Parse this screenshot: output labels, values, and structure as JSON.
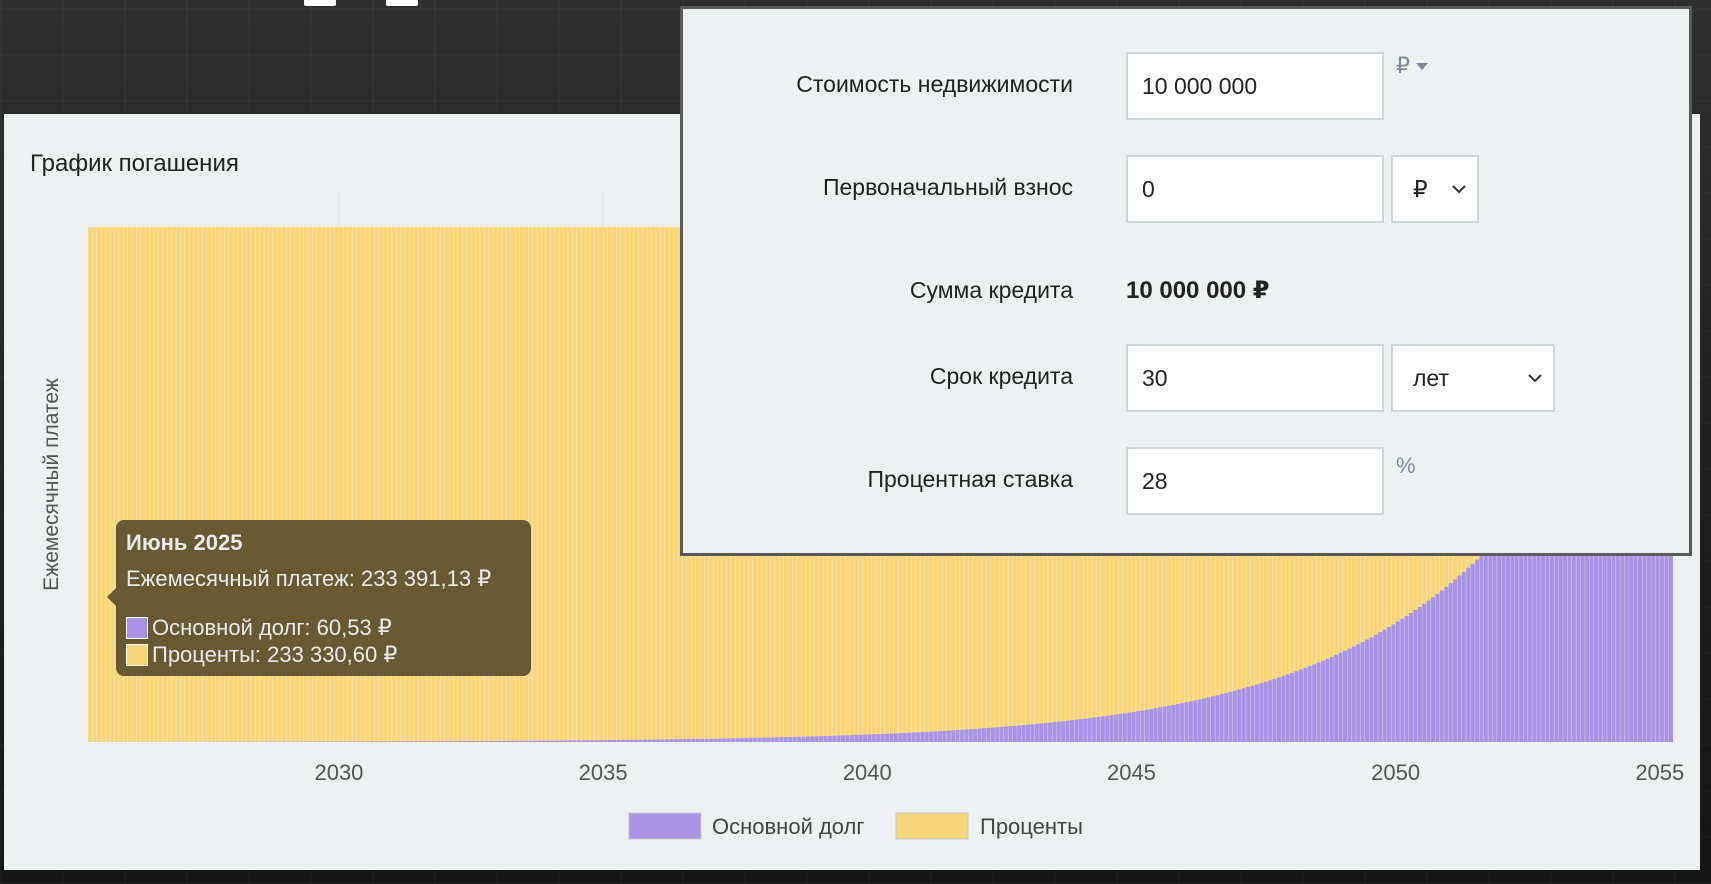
{
  "chart": {
    "title": "График погашения",
    "tooltip": {
      "title": "Июнь 2025",
      "monthly_payment": "Ежемесячный платеж: 233 391,13 ₽",
      "principal": "Основной долг: 60,53 ₽",
      "interest": "Проценты: 233 330,60 ₽"
    }
  },
  "form": {
    "property_cost": {
      "label": "Стоимость недвижимости",
      "value": "10 000 000",
      "unit": "₽"
    },
    "down_payment": {
      "label": "Первоначальный взнос",
      "value": "0",
      "unit_select": "₽"
    },
    "loan_amount": {
      "label": "Сумма кредита",
      "value": "10 000 000 ₽"
    },
    "loan_term": {
      "label": "Срок кредита",
      "value": "30",
      "unit_select": "лет"
    },
    "interest_rate": {
      "label": "Процентная ставка",
      "value": "28",
      "unit": "%"
    }
  },
  "colors": {
    "principal": "#a993e4",
    "interest": "#f8d77a",
    "card_bg": "#ecf0f1",
    "tooltip_bg": "#5c502d"
  },
  "chart_data": {
    "type": "bar",
    "stacked": true,
    "ylabel": "Ежемесячный платеж",
    "x_ticks": [
      "2030",
      "2035",
      "2040",
      "2045",
      "2050",
      "2055"
    ],
    "x_range_years": [
      2025.25,
      2055.25
    ],
    "monthly_payment": 233391.13,
    "annual_rate": 0.28,
    "months": 360,
    "series": [
      {
        "name": "Основной долг",
        "first_value": 60.53
      },
      {
        "name": "Проценты",
        "first_value": 233330.6
      }
    ],
    "legend": [
      "Основной долг",
      "Проценты"
    ],
    "legend_position": "bottom",
    "grid": true
  }
}
